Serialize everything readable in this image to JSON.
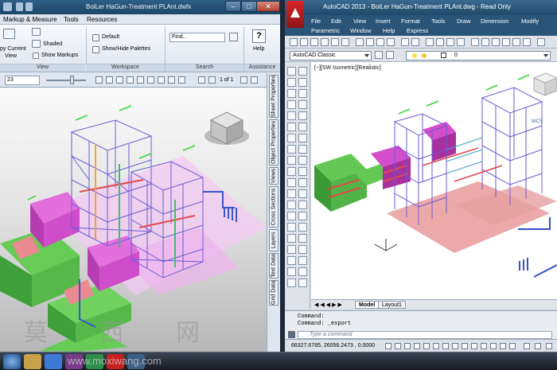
{
  "left_window": {
    "title": "BoiLer HaGun-Treatment PLAnt.dwfx",
    "menu": [
      "Markup & Measure",
      "Tools",
      "Resources"
    ],
    "ribbon": {
      "copy_current_view": "py Current",
      "view_word": "View",
      "shaded": "Shaded",
      "show_markups": "Show Markups",
      "default": "Default",
      "show_hide_palettes": "Show/Hide Palettes",
      "find_placeholder": "Find...",
      "help": "Help",
      "panels": [
        "View",
        "Workspace",
        "Search",
        "Assistance"
      ]
    },
    "toolbar": {
      "zoom_value": "23",
      "page_of": "1 of 1"
    },
    "palette_tabs": [
      "Sheet Properties",
      "Object Properties",
      "Views",
      "Cross Sections",
      "Layers",
      "Text Data",
      "Grid Data"
    ]
  },
  "right_window": {
    "title": "AutoCAD 2013 - BoiLer HaGun-Treatment PLAnt.dwg - Read Only",
    "menu_row1": [
      "File",
      "Edit",
      "View",
      "Insert",
      "Format",
      "Tools",
      "Draw",
      "Dimension",
      "Modify"
    ],
    "menu_row2": [
      "Parametric",
      "Window",
      "Help",
      "Express"
    ],
    "workspace": "AutoCAD Classic",
    "layer": "0",
    "viewport_label": "[−][SW Isometric][Realistic]",
    "wcs": "WCS",
    "layout_tabs": [
      "Model",
      "Layout1"
    ],
    "command_history": [
      "Command:",
      "Command: _export"
    ],
    "command_placeholder": "Type a command",
    "coordinates": "66327.6785, 26056.2473 , 0.0000"
  },
  "watermark": "莫 西 网",
  "watermark_url": "www.moxiwang.com",
  "colors": {
    "titlebar": "#2d5f86",
    "menubar_dark": "#2a5478",
    "autocad_red": "#c8201f",
    "structure_purple": "#7b5bd0",
    "boiler_magenta": "#cf3ec9",
    "green_blocks": "#6cd05a",
    "floor_pink": "#e8a3a3",
    "pipe_blue": "#3a56c8"
  }
}
